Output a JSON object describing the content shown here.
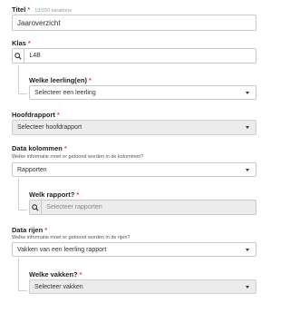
{
  "titel": {
    "label": "Titel",
    "counter": "13/150 karakters",
    "value": "Jaaroverzicht"
  },
  "klas": {
    "label": "Klas",
    "value": "L4B"
  },
  "leerling": {
    "label": "Welke leerling(en)",
    "value": "Selecteer een leerling"
  },
  "hoofdrapport": {
    "label": "Hoofdrapport",
    "value": "Selecteer hoofdrapport"
  },
  "kolommen": {
    "label": "Data kolommen",
    "help": "Welke informatie moet er getoond worden in de kolommen?",
    "value": "Rapporten"
  },
  "rapport": {
    "label": "Welk rapport?",
    "placeholder": "Selecteer rapporten"
  },
  "rijen": {
    "label": "Data rijen",
    "help": "Welke informatie moet er getoond worden in de rijen?",
    "value": "Vakken van een leerling rapport"
  },
  "vakken": {
    "label": "Welke vakken?",
    "value": "Selecteer vakken"
  },
  "required_mark": "*"
}
